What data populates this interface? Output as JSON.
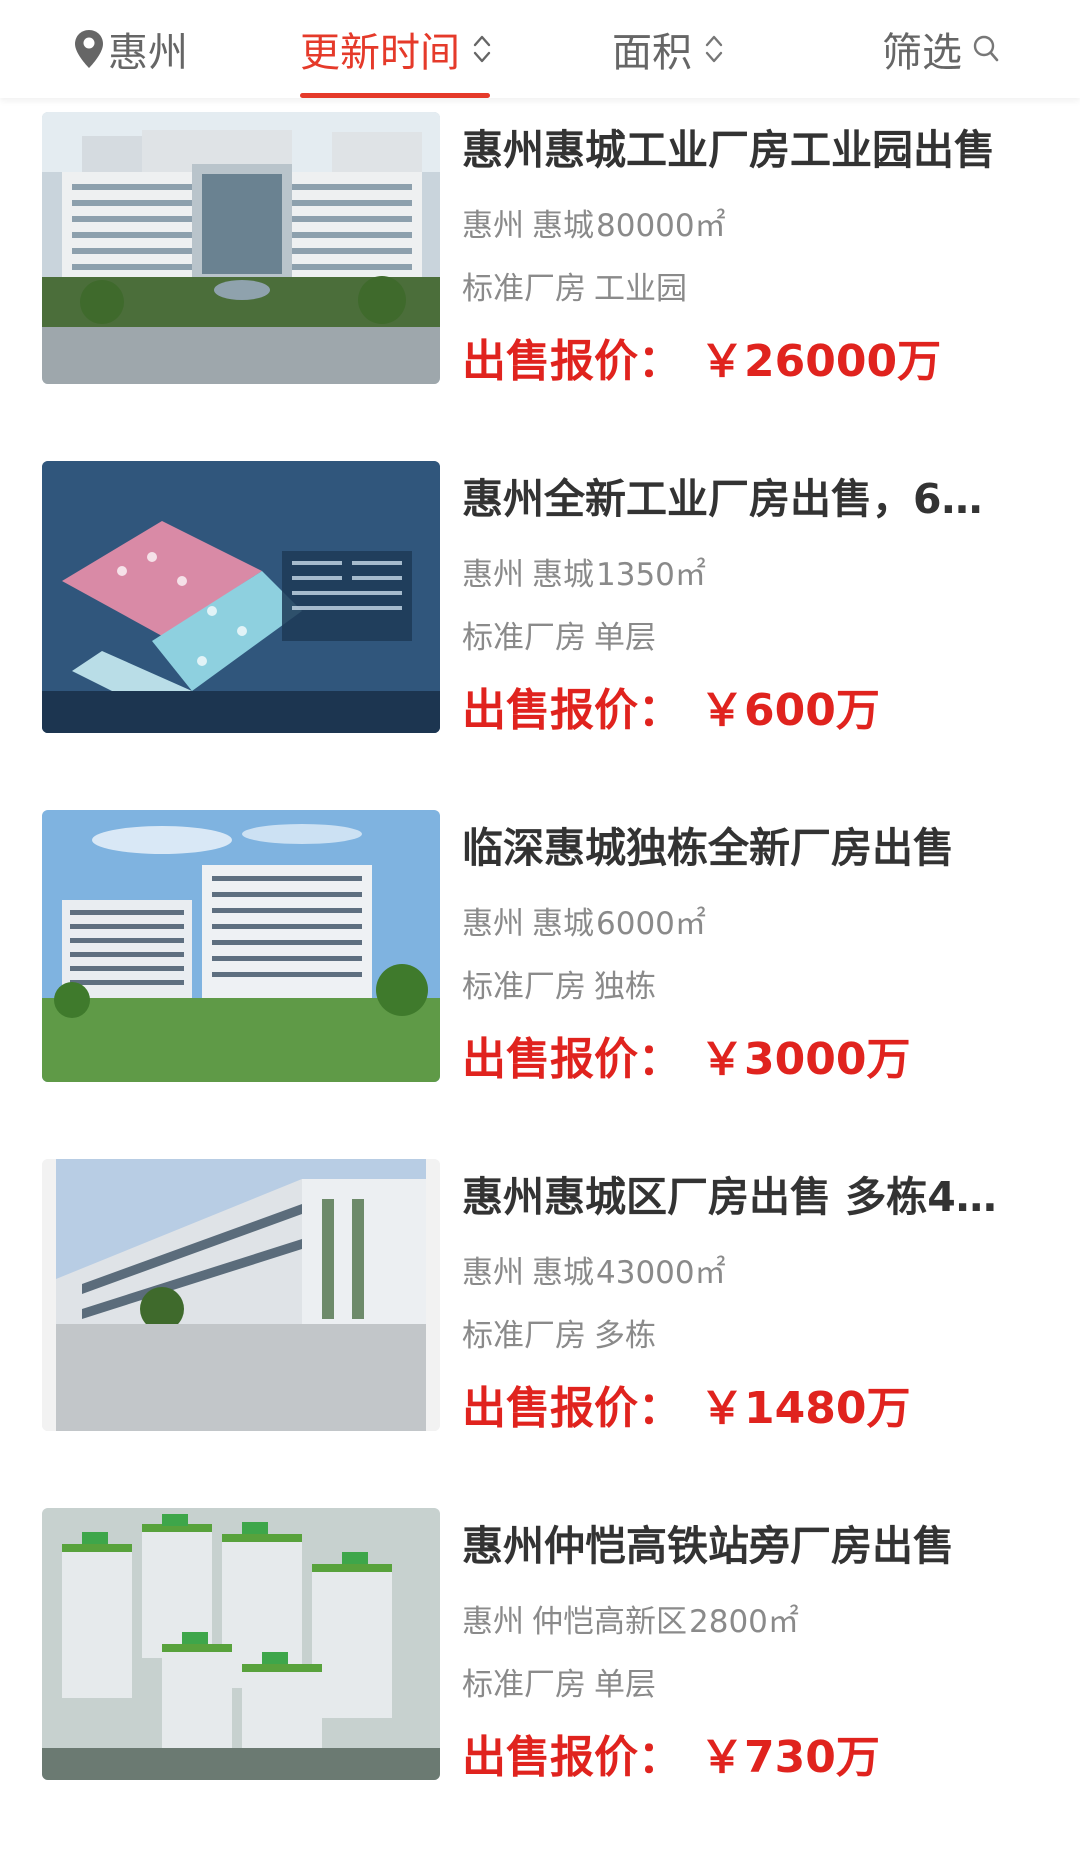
{
  "filter_bar": {
    "city": "惠州",
    "sort_time": "更新时间",
    "sort_area": "面积",
    "filter": "筛选",
    "active_color": "#e53a2a",
    "city_icon": "location-pin-icon",
    "sort_icon": "sort-arrows-icon",
    "filter_icon": "search-icon"
  },
  "price_color": "#e0231e",
  "listings": [
    {
      "title": "惠州惠城工业厂房工业园出售",
      "city": "惠州",
      "district": "惠城",
      "area": "80000㎡",
      "tag1": "标准厂房",
      "tag2": "工业园",
      "price_label": "出售报价：",
      "price": "￥26000万"
    },
    {
      "title": "惠州全新工业厂房出售，6…",
      "city": "惠州",
      "district": "惠城",
      "area": "1350㎡",
      "tag1": "标准厂房",
      "tag2": "单层",
      "price_label": "出售报价：",
      "price": "￥600万"
    },
    {
      "title": "临深惠城独栋全新厂房出售",
      "city": "惠州",
      "district": "惠城",
      "area": "6000㎡",
      "tag1": "标准厂房",
      "tag2": "独栋",
      "price_label": "出售报价：",
      "price": "￥3000万"
    },
    {
      "title": "惠州惠城区厂房出售 多栋4…",
      "city": "惠州",
      "district": "惠城",
      "area": "43000㎡",
      "tag1": "标准厂房",
      "tag2": "多栋",
      "price_label": "出售报价：",
      "price": "￥1480万"
    },
    {
      "title": "惠州仲恺高铁站旁厂房出售",
      "city": "惠州",
      "district": "仲恺高新区",
      "area": "2800㎡",
      "tag1": "标准厂房",
      "tag2": "单层",
      "price_label": "出售报价：",
      "price": "￥730万"
    }
  ]
}
